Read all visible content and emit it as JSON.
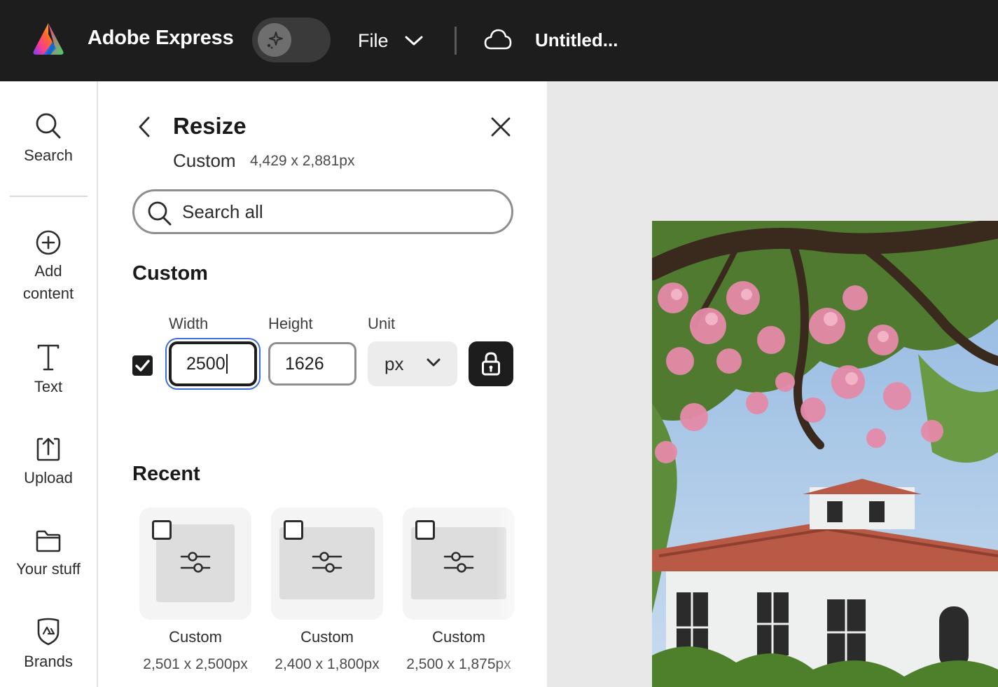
{
  "header": {
    "app_name": "Adobe Express",
    "file_label": "File",
    "doc_title": "Untitled...",
    "icons": [
      "adobe-express-logo",
      "magic-sparkle-icon",
      "chevron-down-icon",
      "cloud-icon"
    ]
  },
  "sidebar": {
    "items": [
      {
        "label": "Search",
        "icon": "search-icon"
      },
      {
        "label": "Add content",
        "icon": "plus-circle-icon"
      },
      {
        "label": "Text",
        "icon": "text-icon"
      },
      {
        "label": "Upload",
        "icon": "upload-icon"
      },
      {
        "label": "Your stuff",
        "icon": "folder-icon"
      },
      {
        "label": "Brands",
        "icon": "brand-shield-icon"
      }
    ],
    "add_content_line1": "Add",
    "add_content_line2": "content"
  },
  "panel": {
    "title": "Resize",
    "current_preset": "Custom",
    "current_size": "4,429 x 2,881px",
    "search_placeholder": "Search all",
    "custom_section": {
      "title": "Custom",
      "width_label": "Width",
      "width_value": "2500",
      "height_label": "Height",
      "height_value": "1626",
      "unit_label": "Unit",
      "unit_value": "px",
      "lock_checked": true,
      "aspect_locked": true
    },
    "recent_section": {
      "title": "Recent",
      "items": [
        {
          "label": "Custom",
          "size": "2,501 x 2,500px"
        },
        {
          "label": "Custom",
          "size": "2,400 x 1,800px"
        },
        {
          "label": "Custom",
          "size": "2,500 x 1,875px"
        }
      ]
    }
  },
  "colors": {
    "topbar": "#1d1d1d",
    "focus_ring": "#3e6cd8",
    "canvas_bg": "#e8e8e8"
  }
}
